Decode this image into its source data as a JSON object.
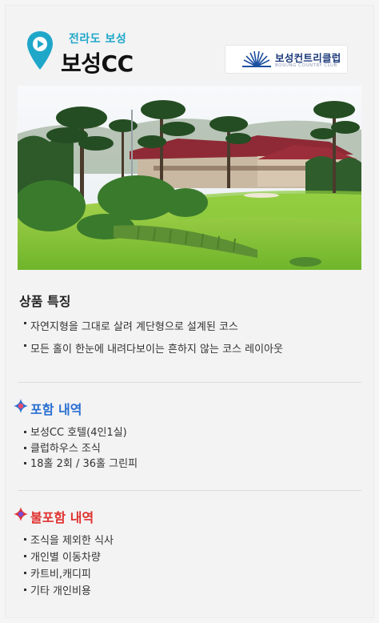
{
  "header": {
    "region": "전라도 보성",
    "title": "보성CC",
    "logo_korean": "보성컨트리클럽",
    "logo_english": "BOSUNG COUNTRY CLUB"
  },
  "features": {
    "title": "상품 특징",
    "items": [
      "자연지형을 그대로 살려 계단형으로 설계된 코스",
      "모든 홀이 한눈에 내려다보이는 흔하지 않는 코스 레이아웃"
    ]
  },
  "included": {
    "title": "포함 내역",
    "items": [
      "보성CC 호텔(4인1실)",
      "클럽하우스 조식",
      "18홀 2회 / 36홀 그린피"
    ]
  },
  "excluded": {
    "title": "불포함 내역",
    "items": [
      "조식을 제외한 식사",
      "개인별 이동차량",
      "카트비,캐디피",
      "기타 개인비용"
    ]
  },
  "colors": {
    "pin": "#1fa7c9",
    "included_title": "#2a6fd1",
    "excluded_title": "#e0312e"
  }
}
